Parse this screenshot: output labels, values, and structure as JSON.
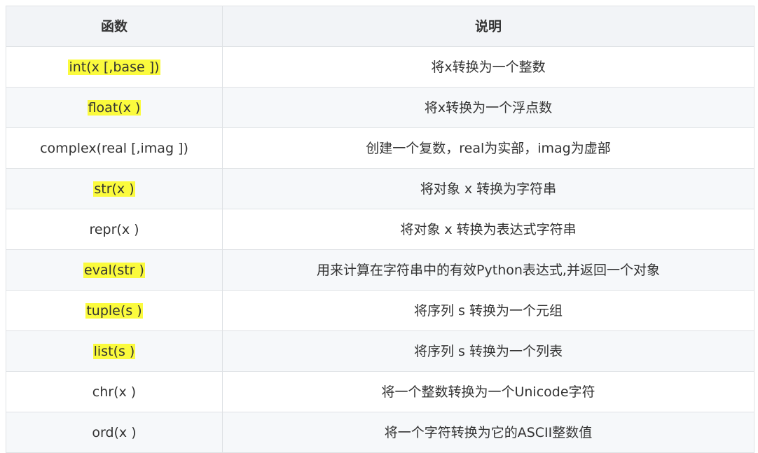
{
  "table": {
    "headers": [
      "函数",
      "说明"
    ],
    "rows": [
      {
        "func": "int(x [,base ])",
        "desc": "将x转换为一个整数",
        "highlight": true
      },
      {
        "func": "float(x )",
        "desc": "将x转换为一个浮点数",
        "highlight": true
      },
      {
        "func": "complex(real [,imag ])",
        "desc": "创建一个复数，real为实部，imag为虚部",
        "highlight": false
      },
      {
        "func": "str(x )",
        "desc": "将对象 x 转换为字符串",
        "highlight": true
      },
      {
        "func": "repr(x )",
        "desc": "将对象 x 转换为表达式字符串",
        "highlight": false
      },
      {
        "func": "eval(str )",
        "desc": "用来计算在字符串中的有效Python表达式,并返回一个对象",
        "highlight": true
      },
      {
        "func": "tuple(s )",
        "desc": "将序列 s 转换为一个元组",
        "highlight": true
      },
      {
        "func": "list(s )",
        "desc": "将序列 s 转换为一个列表",
        "highlight": true
      },
      {
        "func": "chr(x )",
        "desc": "将一个整数转换为一个Unicode字符",
        "highlight": false
      },
      {
        "func": "ord(x )",
        "desc": "将一个字符转换为它的ASCII整数值",
        "highlight": false
      }
    ]
  },
  "colors": {
    "highlight": "#fbfb3d",
    "header_bg": "#f2f4f7",
    "stripe_bg": "#f6f8fa",
    "border": "#dfe2e5",
    "text": "#333333"
  }
}
